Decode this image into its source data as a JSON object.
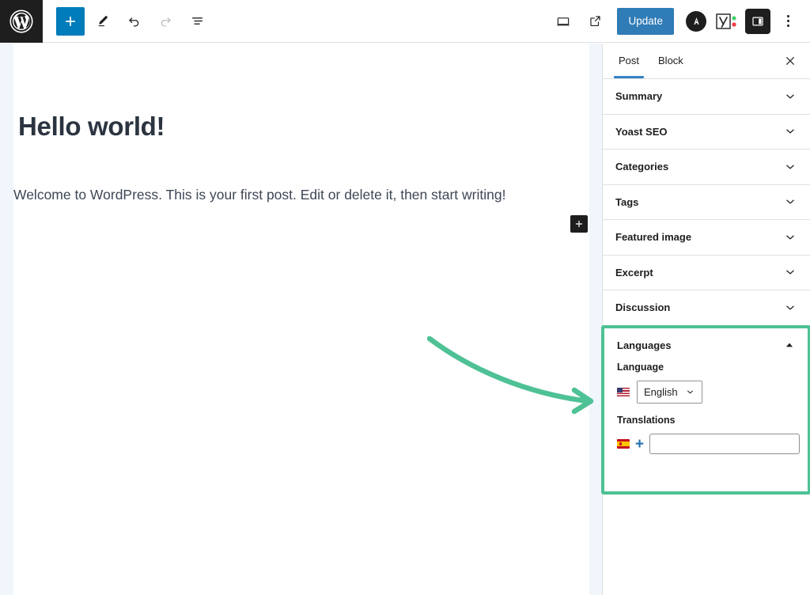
{
  "header": {
    "logo_icon": "wordpress-logo-icon",
    "left_tools": [
      {
        "name": "block-inserter-button",
        "icon": "plus-icon",
        "label": "Toggle block inserter",
        "style": "primary"
      },
      {
        "name": "tools-edit-button",
        "icon": "pencil-icon",
        "label": "Tools",
        "style": "normal"
      },
      {
        "name": "undo-button",
        "icon": "undo-arrow-icon",
        "label": "Undo",
        "style": "normal"
      },
      {
        "name": "redo-button",
        "icon": "redo-arrow-icon",
        "label": "Redo",
        "style": "disabled"
      },
      {
        "name": "document-overview-button",
        "icon": "list-view-icon",
        "label": "Document Overview",
        "style": "normal"
      }
    ],
    "right_tools": [
      {
        "name": "view-device-button",
        "icon": "desktop-icon",
        "label": "View"
      },
      {
        "name": "preview-external-button",
        "icon": "external-link-icon",
        "label": "Preview in new tab"
      }
    ],
    "update_label": "Update",
    "plugin_icons": [
      {
        "name": "akismet-icon",
        "glyph": "A",
        "label": "Akismet"
      },
      {
        "name": "yoast-seo-icon",
        "glyph": "Y",
        "label": "Yoast SEO"
      }
    ],
    "settings_toggle": {
      "name": "settings-sidebar-toggle",
      "icon": "sidebar-panel-icon",
      "label": "Settings"
    },
    "options_menu": {
      "name": "options-menu-button",
      "icon": "vertical-dots-icon",
      "label": "Options"
    }
  },
  "editor": {
    "post_title": "Hello world!",
    "post_paragraph": "Welcome to WordPress. This is your first post. Edit or delete it, then start writing!",
    "appender_label": "+",
    "appender_icon": "plus-icon"
  },
  "annotation": {
    "arrow_color": "#4ec195",
    "highlight_color": "#4ec195",
    "arrow_name": "green-pointer-arrow"
  },
  "sidebar": {
    "tabs": [
      {
        "label": "Post",
        "active": true
      },
      {
        "label": "Block",
        "active": false
      }
    ],
    "close_label": "Close Settings",
    "close_icon": "close-x-icon",
    "panels": [
      {
        "label": "Summary",
        "icon": "chevron-down-icon",
        "expanded": false
      },
      {
        "label": "Yoast SEO",
        "icon": "chevron-down-icon",
        "expanded": false
      },
      {
        "label": "Categories",
        "icon": "chevron-down-icon",
        "expanded": false
      },
      {
        "label": "Tags",
        "icon": "chevron-down-icon",
        "expanded": false
      },
      {
        "label": "Featured image",
        "icon": "chevron-down-icon",
        "expanded": false
      },
      {
        "label": "Excerpt",
        "icon": "chevron-down-icon",
        "expanded": false
      },
      {
        "label": "Discussion",
        "icon": "chevron-down-icon",
        "expanded": false
      }
    ],
    "languages_panel": {
      "title": "Languages",
      "toggle_icon": "chevron-up-icon",
      "expanded": true,
      "language_field_label": "Language",
      "language_flag": "flag-us-icon",
      "language_value": "English",
      "language_select_icon": "chevron-down-icon",
      "translations_field_label": "Translations",
      "translation_flag": "flag-es-icon",
      "add_translation_icon": "plus-icon",
      "translation_input_value": "",
      "translation_input_placeholder": ""
    }
  },
  "colors": {
    "accent_blue": "#2f7cb6",
    "inserter_blue": "#007cba",
    "tab_underline": "#3582c4",
    "highlight_green": "#4ec195",
    "dark": "#1e1e1e"
  }
}
